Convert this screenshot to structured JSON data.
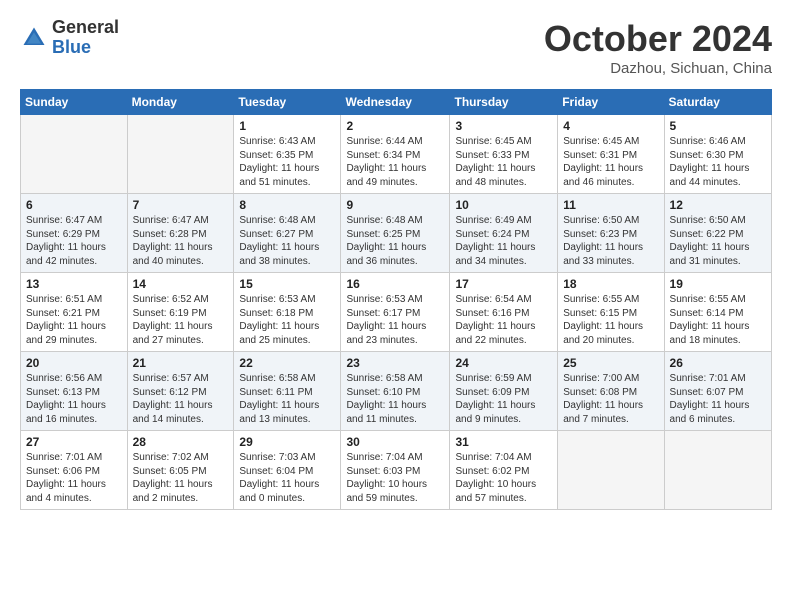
{
  "logo": {
    "general": "General",
    "blue": "Blue"
  },
  "title": "October 2024",
  "location": "Dazhou, Sichuan, China",
  "headers": [
    "Sunday",
    "Monday",
    "Tuesday",
    "Wednesday",
    "Thursday",
    "Friday",
    "Saturday"
  ],
  "weeks": [
    [
      {
        "day": "",
        "info": ""
      },
      {
        "day": "",
        "info": ""
      },
      {
        "day": "1",
        "info": "Sunrise: 6:43 AM\nSunset: 6:35 PM\nDaylight: 11 hours and 51 minutes."
      },
      {
        "day": "2",
        "info": "Sunrise: 6:44 AM\nSunset: 6:34 PM\nDaylight: 11 hours and 49 minutes."
      },
      {
        "day": "3",
        "info": "Sunrise: 6:45 AM\nSunset: 6:33 PM\nDaylight: 11 hours and 48 minutes."
      },
      {
        "day": "4",
        "info": "Sunrise: 6:45 AM\nSunset: 6:31 PM\nDaylight: 11 hours and 46 minutes."
      },
      {
        "day": "5",
        "info": "Sunrise: 6:46 AM\nSunset: 6:30 PM\nDaylight: 11 hours and 44 minutes."
      }
    ],
    [
      {
        "day": "6",
        "info": "Sunrise: 6:47 AM\nSunset: 6:29 PM\nDaylight: 11 hours and 42 minutes."
      },
      {
        "day": "7",
        "info": "Sunrise: 6:47 AM\nSunset: 6:28 PM\nDaylight: 11 hours and 40 minutes."
      },
      {
        "day": "8",
        "info": "Sunrise: 6:48 AM\nSunset: 6:27 PM\nDaylight: 11 hours and 38 minutes."
      },
      {
        "day": "9",
        "info": "Sunrise: 6:48 AM\nSunset: 6:25 PM\nDaylight: 11 hours and 36 minutes."
      },
      {
        "day": "10",
        "info": "Sunrise: 6:49 AM\nSunset: 6:24 PM\nDaylight: 11 hours and 34 minutes."
      },
      {
        "day": "11",
        "info": "Sunrise: 6:50 AM\nSunset: 6:23 PM\nDaylight: 11 hours and 33 minutes."
      },
      {
        "day": "12",
        "info": "Sunrise: 6:50 AM\nSunset: 6:22 PM\nDaylight: 11 hours and 31 minutes."
      }
    ],
    [
      {
        "day": "13",
        "info": "Sunrise: 6:51 AM\nSunset: 6:21 PM\nDaylight: 11 hours and 29 minutes."
      },
      {
        "day": "14",
        "info": "Sunrise: 6:52 AM\nSunset: 6:19 PM\nDaylight: 11 hours and 27 minutes."
      },
      {
        "day": "15",
        "info": "Sunrise: 6:53 AM\nSunset: 6:18 PM\nDaylight: 11 hours and 25 minutes."
      },
      {
        "day": "16",
        "info": "Sunrise: 6:53 AM\nSunset: 6:17 PM\nDaylight: 11 hours and 23 minutes."
      },
      {
        "day": "17",
        "info": "Sunrise: 6:54 AM\nSunset: 6:16 PM\nDaylight: 11 hours and 22 minutes."
      },
      {
        "day": "18",
        "info": "Sunrise: 6:55 AM\nSunset: 6:15 PM\nDaylight: 11 hours and 20 minutes."
      },
      {
        "day": "19",
        "info": "Sunrise: 6:55 AM\nSunset: 6:14 PM\nDaylight: 11 hours and 18 minutes."
      }
    ],
    [
      {
        "day": "20",
        "info": "Sunrise: 6:56 AM\nSunset: 6:13 PM\nDaylight: 11 hours and 16 minutes."
      },
      {
        "day": "21",
        "info": "Sunrise: 6:57 AM\nSunset: 6:12 PM\nDaylight: 11 hours and 14 minutes."
      },
      {
        "day": "22",
        "info": "Sunrise: 6:58 AM\nSunset: 6:11 PM\nDaylight: 11 hours and 13 minutes."
      },
      {
        "day": "23",
        "info": "Sunrise: 6:58 AM\nSunset: 6:10 PM\nDaylight: 11 hours and 11 minutes."
      },
      {
        "day": "24",
        "info": "Sunrise: 6:59 AM\nSunset: 6:09 PM\nDaylight: 11 hours and 9 minutes."
      },
      {
        "day": "25",
        "info": "Sunrise: 7:00 AM\nSunset: 6:08 PM\nDaylight: 11 hours and 7 minutes."
      },
      {
        "day": "26",
        "info": "Sunrise: 7:01 AM\nSunset: 6:07 PM\nDaylight: 11 hours and 6 minutes."
      }
    ],
    [
      {
        "day": "27",
        "info": "Sunrise: 7:01 AM\nSunset: 6:06 PM\nDaylight: 11 hours and 4 minutes."
      },
      {
        "day": "28",
        "info": "Sunrise: 7:02 AM\nSunset: 6:05 PM\nDaylight: 11 hours and 2 minutes."
      },
      {
        "day": "29",
        "info": "Sunrise: 7:03 AM\nSunset: 6:04 PM\nDaylight: 11 hours and 0 minutes."
      },
      {
        "day": "30",
        "info": "Sunrise: 7:04 AM\nSunset: 6:03 PM\nDaylight: 10 hours and 59 minutes."
      },
      {
        "day": "31",
        "info": "Sunrise: 7:04 AM\nSunset: 6:02 PM\nDaylight: 10 hours and 57 minutes."
      },
      {
        "day": "",
        "info": ""
      },
      {
        "day": "",
        "info": ""
      }
    ]
  ]
}
